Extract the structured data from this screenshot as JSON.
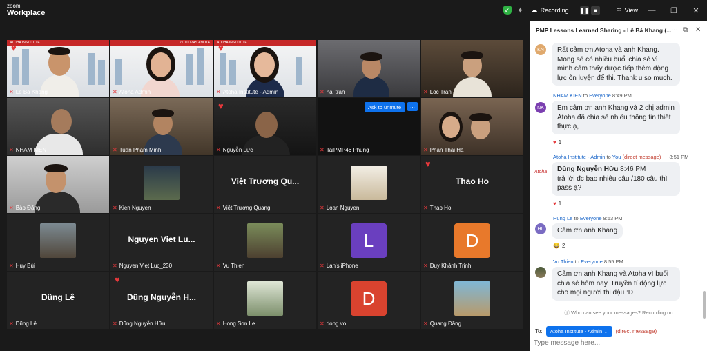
{
  "app": {
    "brand_line1": "zoom",
    "brand_line2": "Workplace"
  },
  "toolbar": {
    "recording_label": "Recording...",
    "view_label": "View"
  },
  "tiles": [
    {
      "name": "Le Ba Khang"
    },
    {
      "name": "Atoha Admin"
    },
    {
      "name": "Atoha Institute - Admin"
    },
    {
      "name": "hai tran"
    },
    {
      "name": "Loc Tran"
    },
    {
      "name": "NHAM KIEN"
    },
    {
      "name": "Tuấn Phạm Minh"
    },
    {
      "name": "Nguyễn Lực"
    },
    {
      "name": "TaiPMP46 Phung"
    },
    {
      "name": "Phan Thái Hà"
    },
    {
      "name": "Bảo Đặng"
    },
    {
      "name": "Kien Nguyen"
    },
    {
      "name": "Việt Trương Quang",
      "big": "Việt Trương Qu..."
    },
    {
      "name": "Loan Nguyen"
    },
    {
      "name": "Thao Ho",
      "big": "Thao Ho"
    },
    {
      "name": "Huy Bùi"
    },
    {
      "name": "Nguyen Viet Luc_230",
      "big": "Nguyen Viet Lu..."
    },
    {
      "name": "Vu Thien"
    },
    {
      "name": "Lan's iPhone",
      "letter": "L"
    },
    {
      "name": "Duy  Khánh Trịnh",
      "letter": "D"
    },
    {
      "name": "Dũng Lê",
      "big": "Dũng Lê"
    },
    {
      "name": "Dũng Nguyễn Hữu",
      "big": "Dũng Nguyễn H..."
    },
    {
      "name": "Hong Son Le"
    },
    {
      "name": "dong vo",
      "letter": "D"
    },
    {
      "name": "Quang Đăng"
    }
  ],
  "banner_texts": {
    "atoha": "ATOHA INSTITUTE",
    "event": "2TUTITZ4S ANOTA"
  },
  "unmute": {
    "label": "Ask to unmute",
    "more": "..."
  },
  "chat": {
    "title": "PMP Lessons Learned Sharing - Lê Bá Khang (...",
    "messages": [
      {
        "initials": "KN",
        "text": "Rất cảm ơn Atoha và anh Khang. Mong sẽ có nhiều buổi chia sẻ vì mình cảm thấy được tiếp thêm động lực ôn luyện để thi. Thank u so much."
      },
      {
        "initials": "NK",
        "sender": "NHAM KIEN",
        "to": "to",
        "recipient": "Everyone",
        "time": "8:49 PM",
        "text": "Em cảm ơn anh Khang và 2 chị admin Atoha đã chia sẻ nhiều thông tin thiết thực ạ,",
        "react_count": "1"
      },
      {
        "sender": "Atoha Institute - Admin",
        "to": "to",
        "recipient": "You",
        "dm": "(direct message)",
        "time": "8:51 PM",
        "bold": "Dũng Nguyễn Hữu",
        "inner_time": "8:46 PM",
        "text": "trả  lời đc bao nhiêu câu  /180 câu thì pass ạ?",
        "react_count": "1",
        "logo": "Atoha"
      },
      {
        "initials": "HL",
        "sender": "Hung Le",
        "to": "to",
        "recipient": "Everyone",
        "time": "8:53 PM",
        "text": "Cảm ơn anh Khang",
        "react_count": "2"
      },
      {
        "sender": "Vu Thien",
        "to": "to",
        "recipient": "Everyone",
        "time": "8:55 PM",
        "text": "Cảm ơn anh Khang và Atoha vì buổi chia sẻ hôm nay. Truyền tí động lực cho mọi người thi đậu :Đ"
      }
    ],
    "privacy": "Who can see your messages? Recording on",
    "to_label": "To:",
    "to_value": "Atoha Institute - Admin",
    "to_dm": "(direct message)",
    "placeholder": "Type message here..."
  },
  "colors": {
    "accent": "#0e72ed",
    "heart": "#e5383b",
    "active": "#35c35a"
  }
}
